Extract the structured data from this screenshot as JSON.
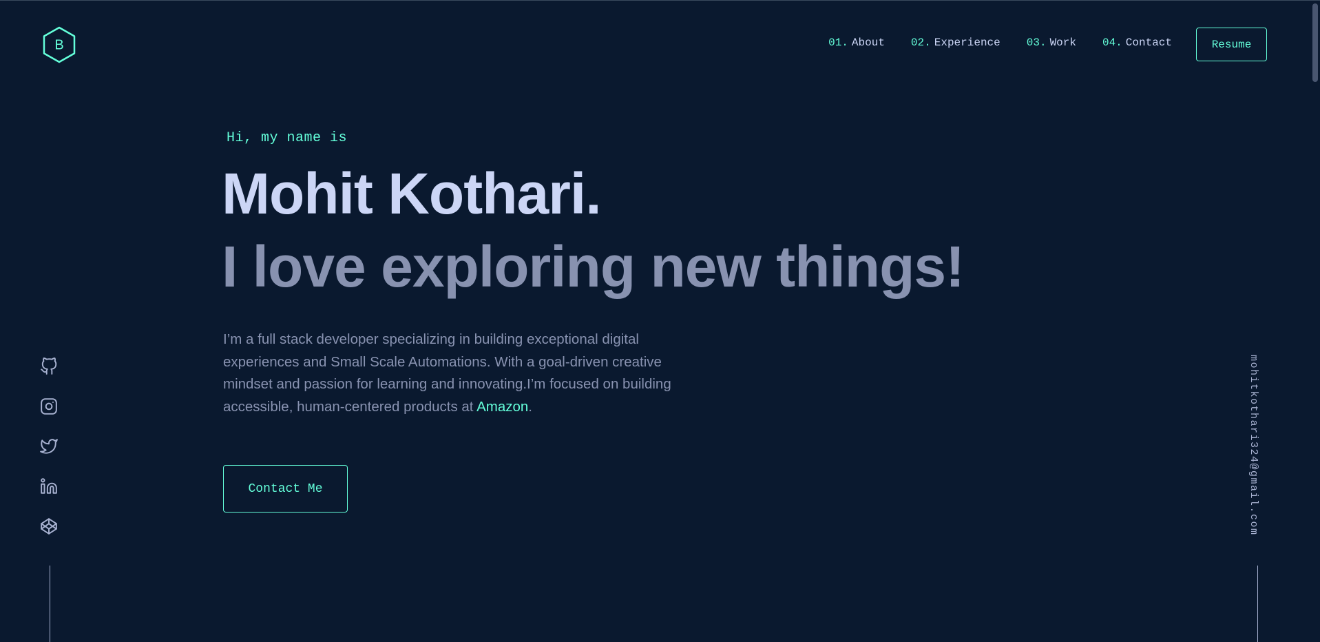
{
  "header": {
    "logo_letter": "B",
    "nav": [
      {
        "num": "01.",
        "label": "About"
      },
      {
        "num": "02.",
        "label": "Experience"
      },
      {
        "num": "03.",
        "label": "Work"
      },
      {
        "num": "04.",
        "label": "Contact"
      }
    ],
    "resume_label": "Resume"
  },
  "hero": {
    "greeting": "Hi, my name is",
    "name": "Mohit Kothari.",
    "tagline": "I love exploring new things!",
    "bio_text": "I’m a full stack developer specializing in building exceptional digital experiences and Small Scale Automations. With a goal-driven creative mindset and passion for learning and innovating.I’m focused on building accessible, human-centered products at ",
    "bio_link": "Amazon",
    "bio_end": ".",
    "contact_label": "Contact Me"
  },
  "socials": [
    {
      "icon": "github-icon"
    },
    {
      "icon": "instagram-icon"
    },
    {
      "icon": "twitter-icon"
    },
    {
      "icon": "linkedin-icon"
    },
    {
      "icon": "codepen-icon"
    }
  ],
  "email": "mohitkothari324@gmail.com",
  "colors": {
    "background": "#0a192f",
    "accent": "#64ffda",
    "heading": "#ccd6f6",
    "muted": "#8892b0",
    "light": "#a8b2d1"
  }
}
